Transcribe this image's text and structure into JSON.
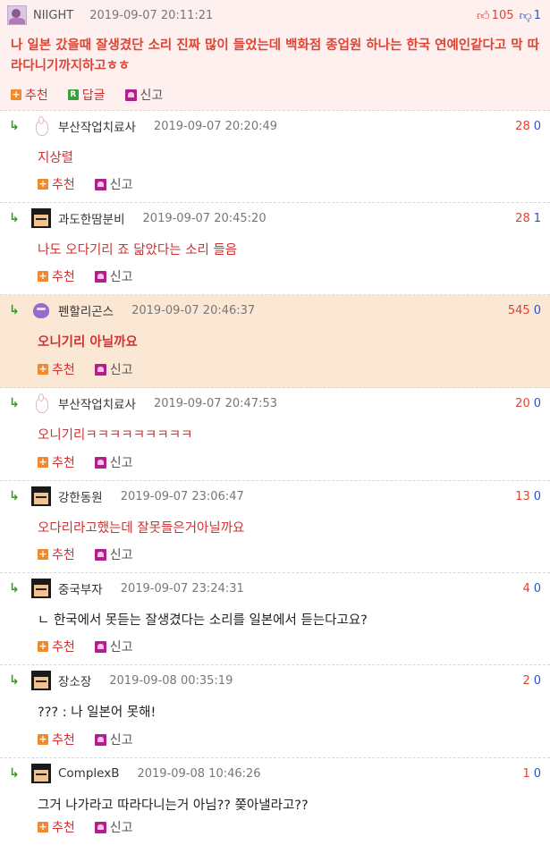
{
  "post": {
    "author": "NIIGHT",
    "date": "2019-09-07 20:11:21",
    "up": "105",
    "down": "1",
    "body": "나 일본 갔을때 잘생겼단 소리 진짜 많이 들었는데 백화점 종업원 하나는 한국 연예인같다고 막 따라다니기까지하고ㅎㅎ",
    "actions": {
      "recommend": "추천",
      "reply": "답글",
      "report": "신고"
    }
  },
  "comments": [
    {
      "author": "부산작업치료사",
      "date": "2019-09-07 20:20:49",
      "up": "28",
      "down": "0",
      "body": "지상렬",
      "avatar": "bunny-icon"
    },
    {
      "author": "과도한땀분비",
      "date": "2019-09-07 20:45:20",
      "up": "28",
      "down": "1",
      "body": "나도 오다기리 죠 닮았다는 소리 들음",
      "avatar": "pixel-face-icon"
    },
    {
      "author": "펜할리곤스",
      "date": "2019-09-07 20:46:37",
      "up": "545",
      "down": "0",
      "body": "오니기리 아닐까요",
      "avatar": "purple-blob-icon",
      "highlight": true
    },
    {
      "author": "부산작업치료사",
      "date": "2019-09-07 20:47:53",
      "up": "20",
      "down": "0",
      "body": "오니기리ㅋㅋㅋㅋㅋㅋㅋㅋㅋ",
      "avatar": "bunny-icon"
    },
    {
      "author": "강한동원",
      "date": "2019-09-07 23:06:47",
      "up": "13",
      "down": "0",
      "body": "오다리라고했는데 잘못들은거아닐까요",
      "avatar": "pixel-face-icon"
    },
    {
      "author": "중국부자",
      "date": "2019-09-07 23:24:31",
      "up": "4",
      "down": "0",
      "body": "ㄴ 한국에서 못듣는 잘생겼다는 소리를 일본에서 듣는다고요?",
      "avatar": "pixel-face-icon"
    },
    {
      "author": "장소장",
      "date": "2019-09-08 00:35:19",
      "up": "2",
      "down": "0",
      "body": "??? : 나 일본어 못해!",
      "avatar": "pixel-face-icon"
    },
    {
      "author": "ComplexB",
      "date": "2019-09-08 10:46:26",
      "up": "1",
      "down": "0",
      "body": "그거 나가라고 따라다니는거 아님?? 쫒아낼라고??",
      "avatar": "pixel-face-icon"
    }
  ],
  "labels": {
    "recommend": "추천",
    "report": "신고"
  },
  "colors": {
    "red": "#d43",
    "blue": "#2a55c4",
    "post_bg": "#fff0f0",
    "highlight_bg": "#fbe8d4"
  }
}
